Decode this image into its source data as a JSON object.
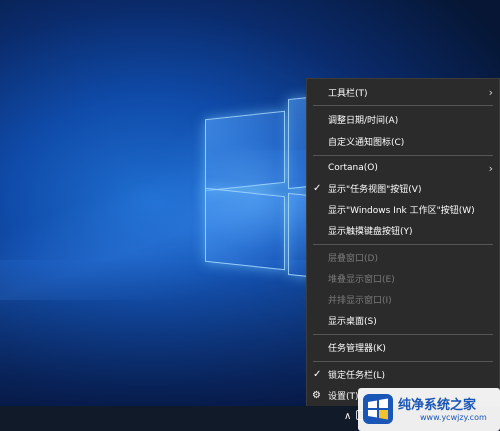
{
  "context_menu": {
    "toolbars": "工具栏(T)",
    "adjust_datetime": "调整日期/时间(A)",
    "customize_notify": "自定义通知图标(C)",
    "cortana": "Cortana(O)",
    "show_taskview": "显示\"任务视图\"按钮(V)",
    "show_ink": "显示\"Windows Ink 工作区\"按钮(W)",
    "show_keyboard": "显示触摸键盘按钮(Y)",
    "cascade": "层叠窗口(D)",
    "stack": "堆叠显示窗口(E)",
    "side_by_side": "并排显示窗口(I)",
    "show_desktop": "显示桌面(S)",
    "task_manager": "任务管理器(K)",
    "lock_taskbar": "锁定任务栏(L)",
    "settings": "设置(T)"
  },
  "watermark": {
    "title": "纯净系统之家",
    "url": "www.ycwjzy.com"
  },
  "colors": {
    "menu_bg": "#2b2b2b",
    "disabled_text": "#7a7a7a",
    "watermark_blue": "#1a56b5"
  }
}
